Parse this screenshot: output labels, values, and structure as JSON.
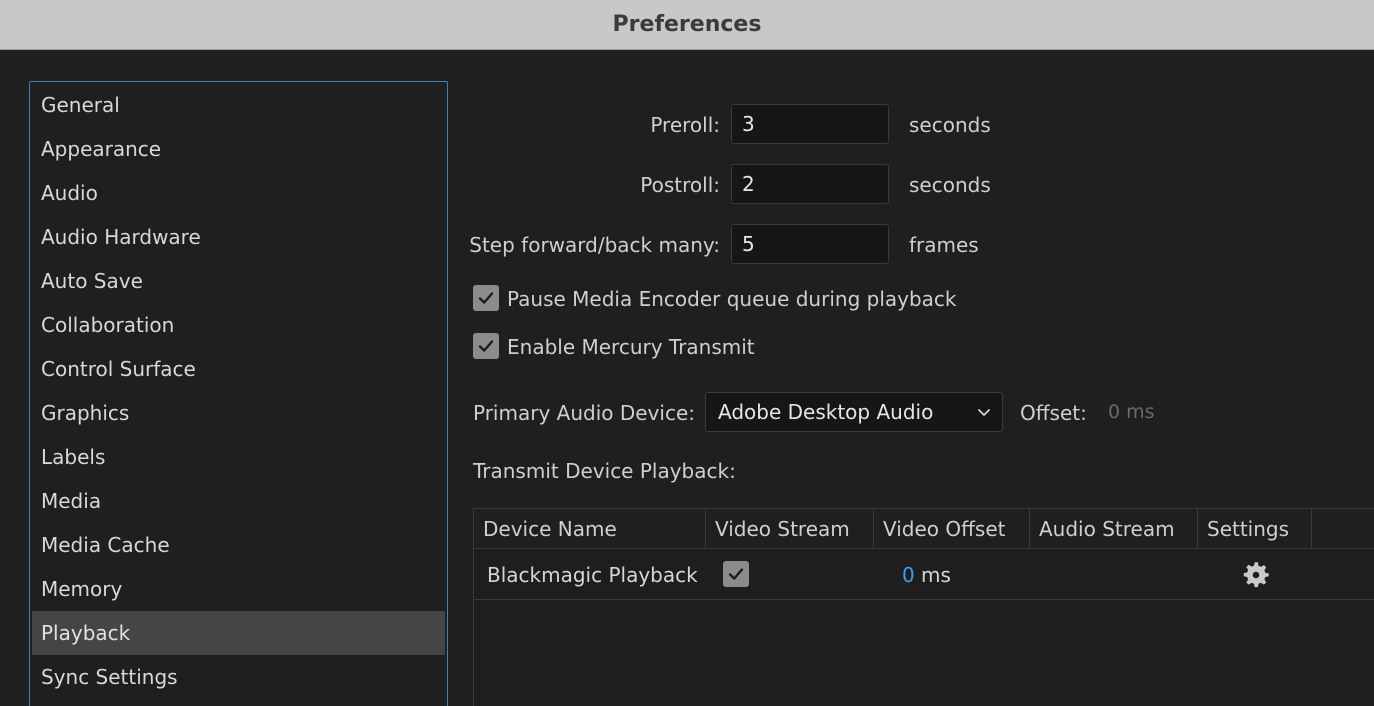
{
  "window": {
    "title": "Preferences"
  },
  "sidebar": {
    "items": [
      {
        "label": "General"
      },
      {
        "label": "Appearance"
      },
      {
        "label": "Audio"
      },
      {
        "label": "Audio Hardware"
      },
      {
        "label": "Auto Save"
      },
      {
        "label": "Collaboration"
      },
      {
        "label": "Control Surface"
      },
      {
        "label": "Graphics"
      },
      {
        "label": "Labels"
      },
      {
        "label": "Media"
      },
      {
        "label": "Media Cache"
      },
      {
        "label": "Memory"
      },
      {
        "label": "Playback",
        "selected": true
      },
      {
        "label": "Sync Settings"
      }
    ]
  },
  "playback": {
    "preroll": {
      "label": "Preroll:",
      "value": "3",
      "unit": "seconds"
    },
    "postroll": {
      "label": "Postroll:",
      "value": "2",
      "unit": "seconds"
    },
    "step": {
      "label": "Step forward/back many:",
      "value": "5",
      "unit": "frames"
    },
    "pause_encoder": {
      "label": "Pause Media Encoder queue during playback",
      "checked": true
    },
    "mercury": {
      "label": "Enable Mercury Transmit",
      "checked": true
    },
    "audio_device": {
      "label": "Primary Audio Device:",
      "value": "Adobe Desktop Audio"
    },
    "offset": {
      "label": "Offset:",
      "value": "0 ms"
    },
    "transmit_label": "Transmit Device Playback:",
    "table": {
      "columns": [
        "Device Name",
        "Video Stream",
        "Video Offset",
        "Audio Stream",
        "Settings"
      ],
      "rows": [
        {
          "device": "Blackmagic Playback",
          "video_stream": true,
          "video_offset": "0",
          "video_offset_unit": "ms",
          "settings_icon": "gear-icon"
        }
      ]
    }
  },
  "colors": {
    "accent": "#3b83c4",
    "link_value": "#3f9de8",
    "selected_bg": "#454545"
  }
}
